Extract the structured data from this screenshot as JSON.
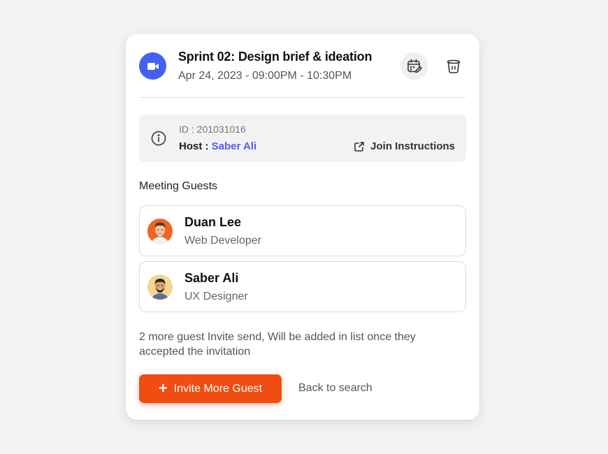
{
  "meeting": {
    "title": "Sprint 02: Design brief & ideation",
    "datetime": "Apr 24, 2023 - 09:00PM - 10:30PM",
    "id_text": "ID : 201031016",
    "host_label": "Host : ",
    "host_name": "Saber Ali",
    "join_label": "Join Instructions"
  },
  "guests": {
    "section_title": "Meeting Guests",
    "items": [
      {
        "name": "Duan Lee",
        "role": "Web Developer"
      },
      {
        "name": "Saber Ali",
        "role": "UX Designer"
      }
    ],
    "note": "2 more guest Invite send, Will be added in list once they accepted the invitation"
  },
  "actions": {
    "invite_label": "Invite More Guest",
    "back_label": "Back to search"
  },
  "colors": {
    "accent": "#f04d12",
    "video_badge": "#4361ee",
    "host_link": "#4f5ef0"
  },
  "icons": [
    "video-camera-icon",
    "calendar-edit-icon",
    "trash-icon",
    "info-icon",
    "external-link-icon",
    "plus-icon"
  ]
}
